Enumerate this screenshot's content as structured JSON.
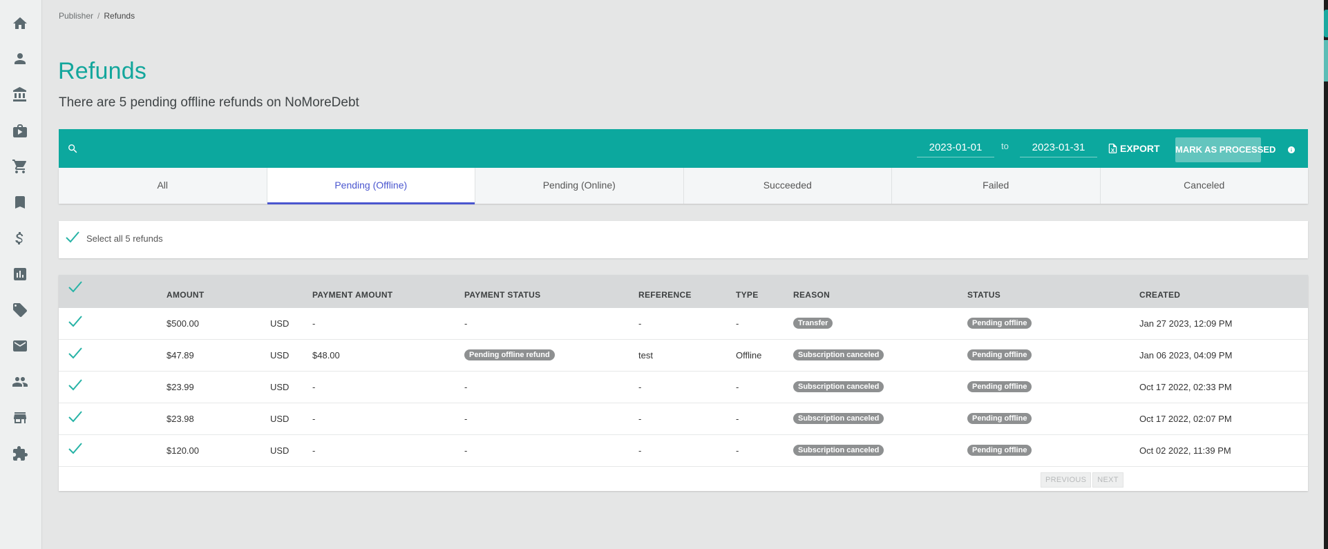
{
  "sidebar": {
    "items": [
      {
        "icon": "home-icon",
        "label": "Home"
      },
      {
        "icon": "person-icon",
        "label": "Account"
      },
      {
        "icon": "bank-icon",
        "label": "Bank"
      },
      {
        "icon": "briefcase-icon",
        "label": "Business"
      },
      {
        "icon": "cart-icon",
        "label": "Orders"
      },
      {
        "icon": "bookmark-icon",
        "label": "Bookmarks"
      },
      {
        "icon": "dollar-icon",
        "label": "Payments"
      },
      {
        "icon": "chart-icon",
        "label": "Reports"
      },
      {
        "icon": "tag-icon",
        "label": "Coupons"
      },
      {
        "icon": "mail-icon",
        "label": "Email"
      },
      {
        "icon": "people-icon",
        "label": "Users"
      },
      {
        "icon": "store-icon",
        "label": "Store"
      },
      {
        "icon": "puzzle-icon",
        "label": "Integrations"
      }
    ]
  },
  "breadcrumb": {
    "parent": "Publisher",
    "separator": "/",
    "current": "Refunds"
  },
  "page": {
    "title": "Refunds",
    "subtitle": "There are 5 pending offline refunds on NoMoreDebt"
  },
  "toolbar": {
    "date_from": "2023-01-01",
    "date_separator": "to",
    "date_to": "2023-01-31",
    "export_label": "EXPORT",
    "mark_processed_label": "MARK AS PROCESSED"
  },
  "tabs": [
    {
      "label": "All",
      "active": false
    },
    {
      "label": "Pending (Offline)",
      "active": true
    },
    {
      "label": "Pending (Online)",
      "active": false
    },
    {
      "label": "Succeeded",
      "active": false
    },
    {
      "label": "Failed",
      "active": false
    },
    {
      "label": "Canceled",
      "active": false
    }
  ],
  "select_all": {
    "label": "Select all 5 refunds"
  },
  "table": {
    "columns": {
      "amount": "AMOUNT",
      "payment_amount": "PAYMENT AMOUNT",
      "payment_status": "PAYMENT STATUS",
      "reference": "REFERENCE",
      "type": "TYPE",
      "reason": "REASON",
      "status": "STATUS",
      "created": "CREATED"
    },
    "rows": [
      {
        "amount": "$500.00",
        "currency": "USD",
        "payment_amount": "-",
        "payment_status": "-",
        "reference": "-",
        "type": "-",
        "reason": "Transfer",
        "status": "Pending offline",
        "created": "Jan 27 2023, 12:09 PM"
      },
      {
        "amount": "$47.89",
        "currency": "USD",
        "payment_amount": "$48.00",
        "payment_status": "Pending offline refund",
        "reference": "test",
        "type": "Offline",
        "reason": "Subscription canceled",
        "status": "Pending offline",
        "created": "Jan 06 2023, 04:09 PM"
      },
      {
        "amount": "$23.99",
        "currency": "USD",
        "payment_amount": "-",
        "payment_status": "-",
        "reference": "-",
        "type": "-",
        "reason": "Subscription canceled",
        "status": "Pending offline",
        "created": "Oct 17 2022, 02:33 PM"
      },
      {
        "amount": "$23.98",
        "currency": "USD",
        "payment_amount": "-",
        "payment_status": "-",
        "reference": "-",
        "type": "-",
        "reason": "Subscription canceled",
        "status": "Pending offline",
        "created": "Oct 17 2022, 02:07 PM"
      },
      {
        "amount": "$120.00",
        "currency": "USD",
        "payment_amount": "-",
        "payment_status": "-",
        "reference": "-",
        "type": "-",
        "reason": "Subscription canceled",
        "status": "Pending offline",
        "created": "Oct 02 2022, 11:39 PM"
      }
    ]
  },
  "pagination": {
    "previous_label": "PREVIOUS",
    "next_label": "NEXT"
  }
}
